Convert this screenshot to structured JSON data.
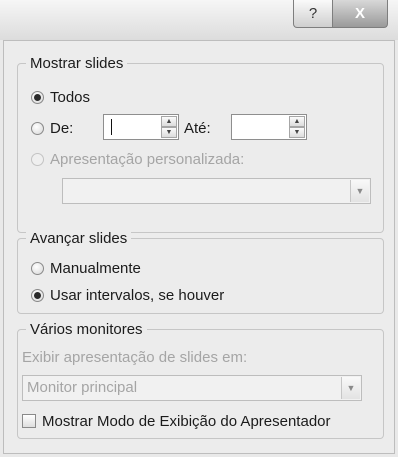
{
  "titlebar": {
    "help_label": "?",
    "close_label": "X"
  },
  "show_slides": {
    "legend": "Mostrar slides",
    "all_label": "Todos",
    "from_label": "De:",
    "from_value": "",
    "to_label": "Até:",
    "to_value": "",
    "custom_label": "Apresentação personalizada:",
    "custom_value": ""
  },
  "advance_slides": {
    "legend": "Avançar slides",
    "manual_label": "Manualmente",
    "timings_label": "Usar intervalos, se houver"
  },
  "monitors": {
    "legend": "Vários monitores",
    "display_label": "Exibir apresentação de slides em:",
    "display_value": "Monitor principal",
    "presenter_view_label": "Mostrar Modo de Exibição do Apresentador"
  }
}
